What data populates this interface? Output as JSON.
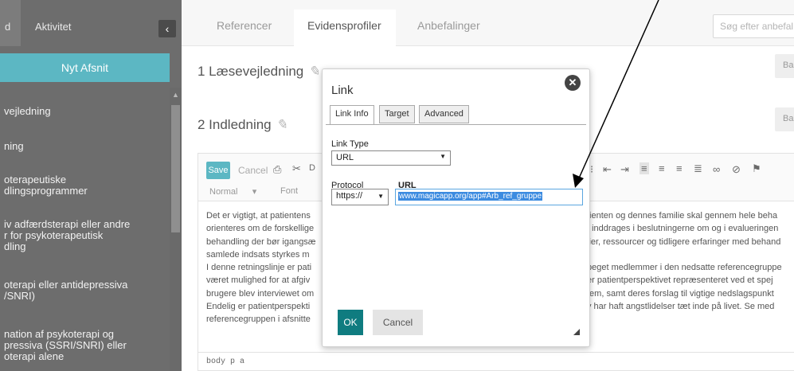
{
  "sidebar": {
    "tabs": [
      {
        "label": "d"
      },
      {
        "label": "Aktivitet"
      }
    ],
    "collapse_icon": "chevron-left-icon",
    "new_section_label": "Nyt Afsnit",
    "items": [
      {
        "label": "vejledning"
      },
      {
        "label": "ning"
      },
      {
        "label": "oterapeutiske\ndlingsprogrammer"
      },
      {
        "label": "iv adfærdsterapi eller andre\nr for psykoterapeutisk\ndling"
      },
      {
        "label": "oterapi eller antidepressiva\n/SNRI)"
      },
      {
        "label": "nation af psykoterapi og\npressiva (SSRI/SNRI) eller\noterapi alene"
      }
    ]
  },
  "topbar": {
    "tabs": [
      {
        "label": "Referencer",
        "active": false
      },
      {
        "label": "Evidensprofiler",
        "active": true
      },
      {
        "label": "Anbefalinger",
        "active": false
      }
    ],
    "search_placeholder": "Søg efter anbefal"
  },
  "sections": [
    {
      "title": "1 Læsevejledning",
      "back_label": "Ba"
    },
    {
      "title": "2 Indledning",
      "back_label": "Ba"
    }
  ],
  "editor": {
    "save_label": "Save",
    "cancel_label": "Cancel",
    "format_label": "Normal",
    "format_arrow": "▾",
    "font_label": "Font",
    "stray_letter": "D",
    "body_lines": [
      "Det er vigtigt, at patientens",
      "orienteres om de forskellige",
      "behandling der bør igangsæ",
      "samlede indsats styrkes m",
      "I denne retningslinje er pati",
      "været mulighed for at afgiv",
      "brugere blev interviewet om",
      "Endelig er patientperspekti",
      "referencegruppen i afsnitte"
    ],
    "body_lines_right": [
      "tienten og dennes familie skal gennem hele beha",
      "t inddrages i beslutningerne om og i evalueringen",
      "lier, ressourcer og tidligere erfaringer med behand",
      "",
      "peget medlemmer i den nedsatte referencegruppe",
      "er patientperspektivet repræsenteret ved et spej",
      "tem, samt deres forslag til vigtige nedslagspunkt",
      "v har haft angstlidelser tæt inde på livet. Se med",
      ""
    ],
    "status_path": "body  p  a"
  },
  "dialog": {
    "title": "Link",
    "close_icon": "close-circle-icon",
    "tabs": [
      {
        "label": "Link Info",
        "active": true
      },
      {
        "label": "Target",
        "active": false
      },
      {
        "label": "Advanced",
        "active": false
      }
    ],
    "link_type_label": "Link Type",
    "link_type_value": "URL",
    "protocol_label": "Protocol",
    "protocol_value": "https://",
    "url_label": "URL",
    "url_value": "www.magicapp.org/app#Arb_ref_gruppe",
    "ok_label": "OK",
    "cancel_label": "Cancel"
  },
  "colors": {
    "sidebar_bg": "#6d6d6d",
    "accent_teal": "#5cb7c3",
    "ok_button": "#0f7c80",
    "selection_blue": "#3c8be0"
  }
}
